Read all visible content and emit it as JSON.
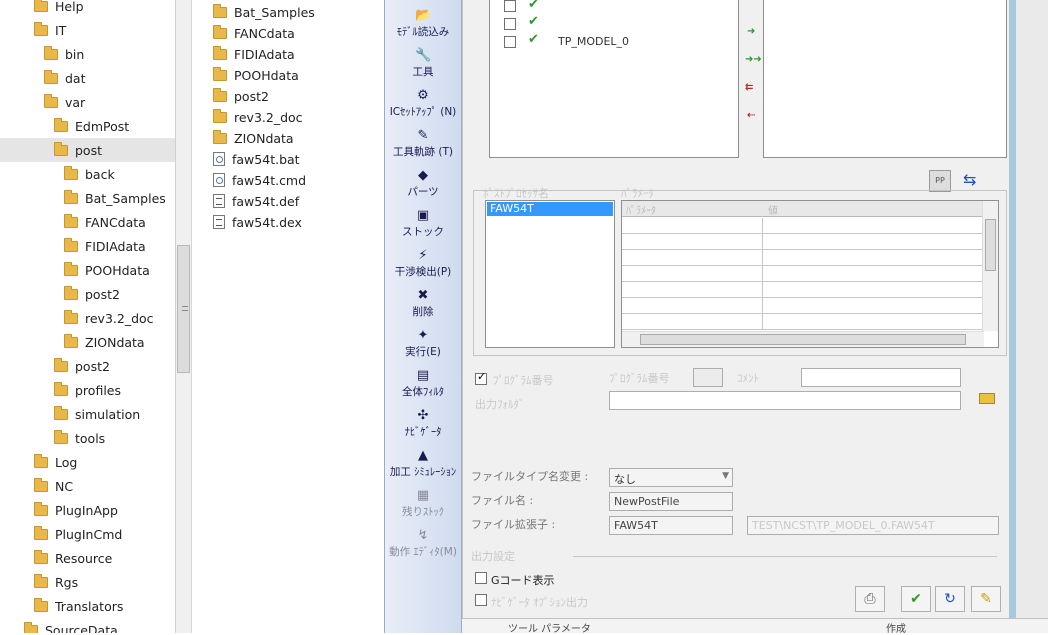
{
  "tree": {
    "items": [
      {
        "label": "Help",
        "depth": 0
      },
      {
        "label": "IT",
        "depth": 0
      },
      {
        "label": "bin",
        "depth": 1
      },
      {
        "label": "dat",
        "depth": 1
      },
      {
        "label": "var",
        "depth": 1
      },
      {
        "label": "EdmPost",
        "depth": 2
      },
      {
        "label": "post",
        "depth": 2,
        "selected": true
      },
      {
        "label": "back",
        "depth": 3
      },
      {
        "label": "Bat_Samples",
        "depth": 3
      },
      {
        "label": "FANCdata",
        "depth": 3
      },
      {
        "label": "FIDIAdata",
        "depth": 3
      },
      {
        "label": "POOHdata",
        "depth": 3
      },
      {
        "label": "post2",
        "depth": 3
      },
      {
        "label": "rev3.2_doc",
        "depth": 3
      },
      {
        "label": "ZIONdata",
        "depth": 3
      },
      {
        "label": "post2",
        "depth": 2
      },
      {
        "label": "profiles",
        "depth": 2
      },
      {
        "label": "simulation",
        "depth": 2
      },
      {
        "label": "tools",
        "depth": 2
      },
      {
        "label": "Log",
        "depth": 0
      },
      {
        "label": "NC",
        "depth": 0
      },
      {
        "label": "PlugInApp",
        "depth": 0
      },
      {
        "label": "PlugInCmd",
        "depth": 0
      },
      {
        "label": "Resource",
        "depth": 0
      },
      {
        "label": "Rgs",
        "depth": 0
      },
      {
        "label": "Translators",
        "depth": 0
      },
      {
        "label": "SourceData",
        "depth": -1
      }
    ]
  },
  "files": [
    {
      "label": "Bat_Samples",
      "kind": "folder"
    },
    {
      "label": "FANCdata",
      "kind": "folder"
    },
    {
      "label": "FIDIAdata",
      "kind": "folder"
    },
    {
      "label": "POOHdata",
      "kind": "folder"
    },
    {
      "label": "post2",
      "kind": "folder"
    },
    {
      "label": "rev3.2_doc",
      "kind": "folder"
    },
    {
      "label": "ZIONdata",
      "kind": "folder"
    },
    {
      "label": "faw54t.bat",
      "kind": "gear"
    },
    {
      "label": "faw54t.cmd",
      "kind": "gear"
    },
    {
      "label": "faw54t.def",
      "kind": "doc"
    },
    {
      "label": "faw54t.dex",
      "kind": "doc"
    }
  ],
  "toolbar": [
    {
      "label": "ﾓﾃﾞﾙ読込み",
      "icon": "folder-open-icon",
      "glyph": "📂"
    },
    {
      "label": "工具",
      "icon": "tool-icon",
      "glyph": "🔧"
    },
    {
      "label": "ICｾｯﾄｱｯﾌﾟ (N)",
      "icon": "setup-icon",
      "glyph": "⚙"
    },
    {
      "label": "工具軌跡 (T)",
      "icon": "toolpath-icon",
      "glyph": "✎"
    },
    {
      "label": "パーツ",
      "icon": "parts-icon",
      "glyph": "◆"
    },
    {
      "label": "ストック",
      "icon": "stock-icon",
      "glyph": "▣"
    },
    {
      "label": "干渉検出(P)",
      "icon": "collision-icon",
      "glyph": "⚡"
    },
    {
      "label": "削除",
      "icon": "delete-icon",
      "glyph": "✖"
    },
    {
      "label": "実行(E)",
      "icon": "run-icon",
      "glyph": "✦"
    },
    {
      "label": "全体ﾌｨﾙﾀ",
      "icon": "filter-icon",
      "glyph": "▤"
    },
    {
      "label": "ﾅﾋﾞｹﾞｰﾀ",
      "icon": "navigator-icon",
      "glyph": "✣"
    },
    {
      "label": "加工 ｼﾐｭﾚｰｼｮﾝ",
      "icon": "simulation-icon",
      "glyph": "▲"
    },
    {
      "label": "残りｽﾄｯｸ",
      "icon": "remaining-stock-icon",
      "glyph": "▦",
      "dim": true
    },
    {
      "label": "動作 ｴﾃﾞｨﾀ(M)",
      "icon": "motion-editor-icon",
      "glyph": "↯",
      "dim": true
    }
  ],
  "dialog": {
    "model_tree": {
      "node_label": "TP_MODEL_0"
    },
    "post_section_label": "ﾎﾟｽﾄﾌﾟﾛｾｯｻ名",
    "post_list": [
      "FAW54T"
    ],
    "params_section_label": "ﾊﾟﾗﾒｰﾀ",
    "grid_headers": [
      "ﾊﾟﾗﾒｰﾀ",
      "値"
    ],
    "checkbox_label": "ﾌﾟﾛｸﾞﾗﾑ番号",
    "prog_no_label": "ﾌﾟﾛｸﾞﾗﾑ番号",
    "comment_label": "ｺﾒﾝﾄ",
    "output_folder_label": "出力ﾌｫﾙﾀﾞ",
    "file_type_label": "ファイルタイプ名変更 :",
    "file_type_value": "なし",
    "file_name_label": "ファイル名 :",
    "file_name_value": "NewPostFile",
    "file_ext_label": "ファイル拡張子 :",
    "file_ext_value": "FAW54T",
    "file_path_value": "TEST\\NCST\\TP_MODEL_0.FAW54T",
    "output_group_label": "出力設定",
    "gcode_label": "Gコード表示",
    "second_check_label": "ﾅﾋﾞｹﾞｰﾀ ｵﾌﾟｼｮﾝ出力",
    "bottom_row_label": "ツール パラメータ",
    "bottom_row_value": "作成"
  }
}
